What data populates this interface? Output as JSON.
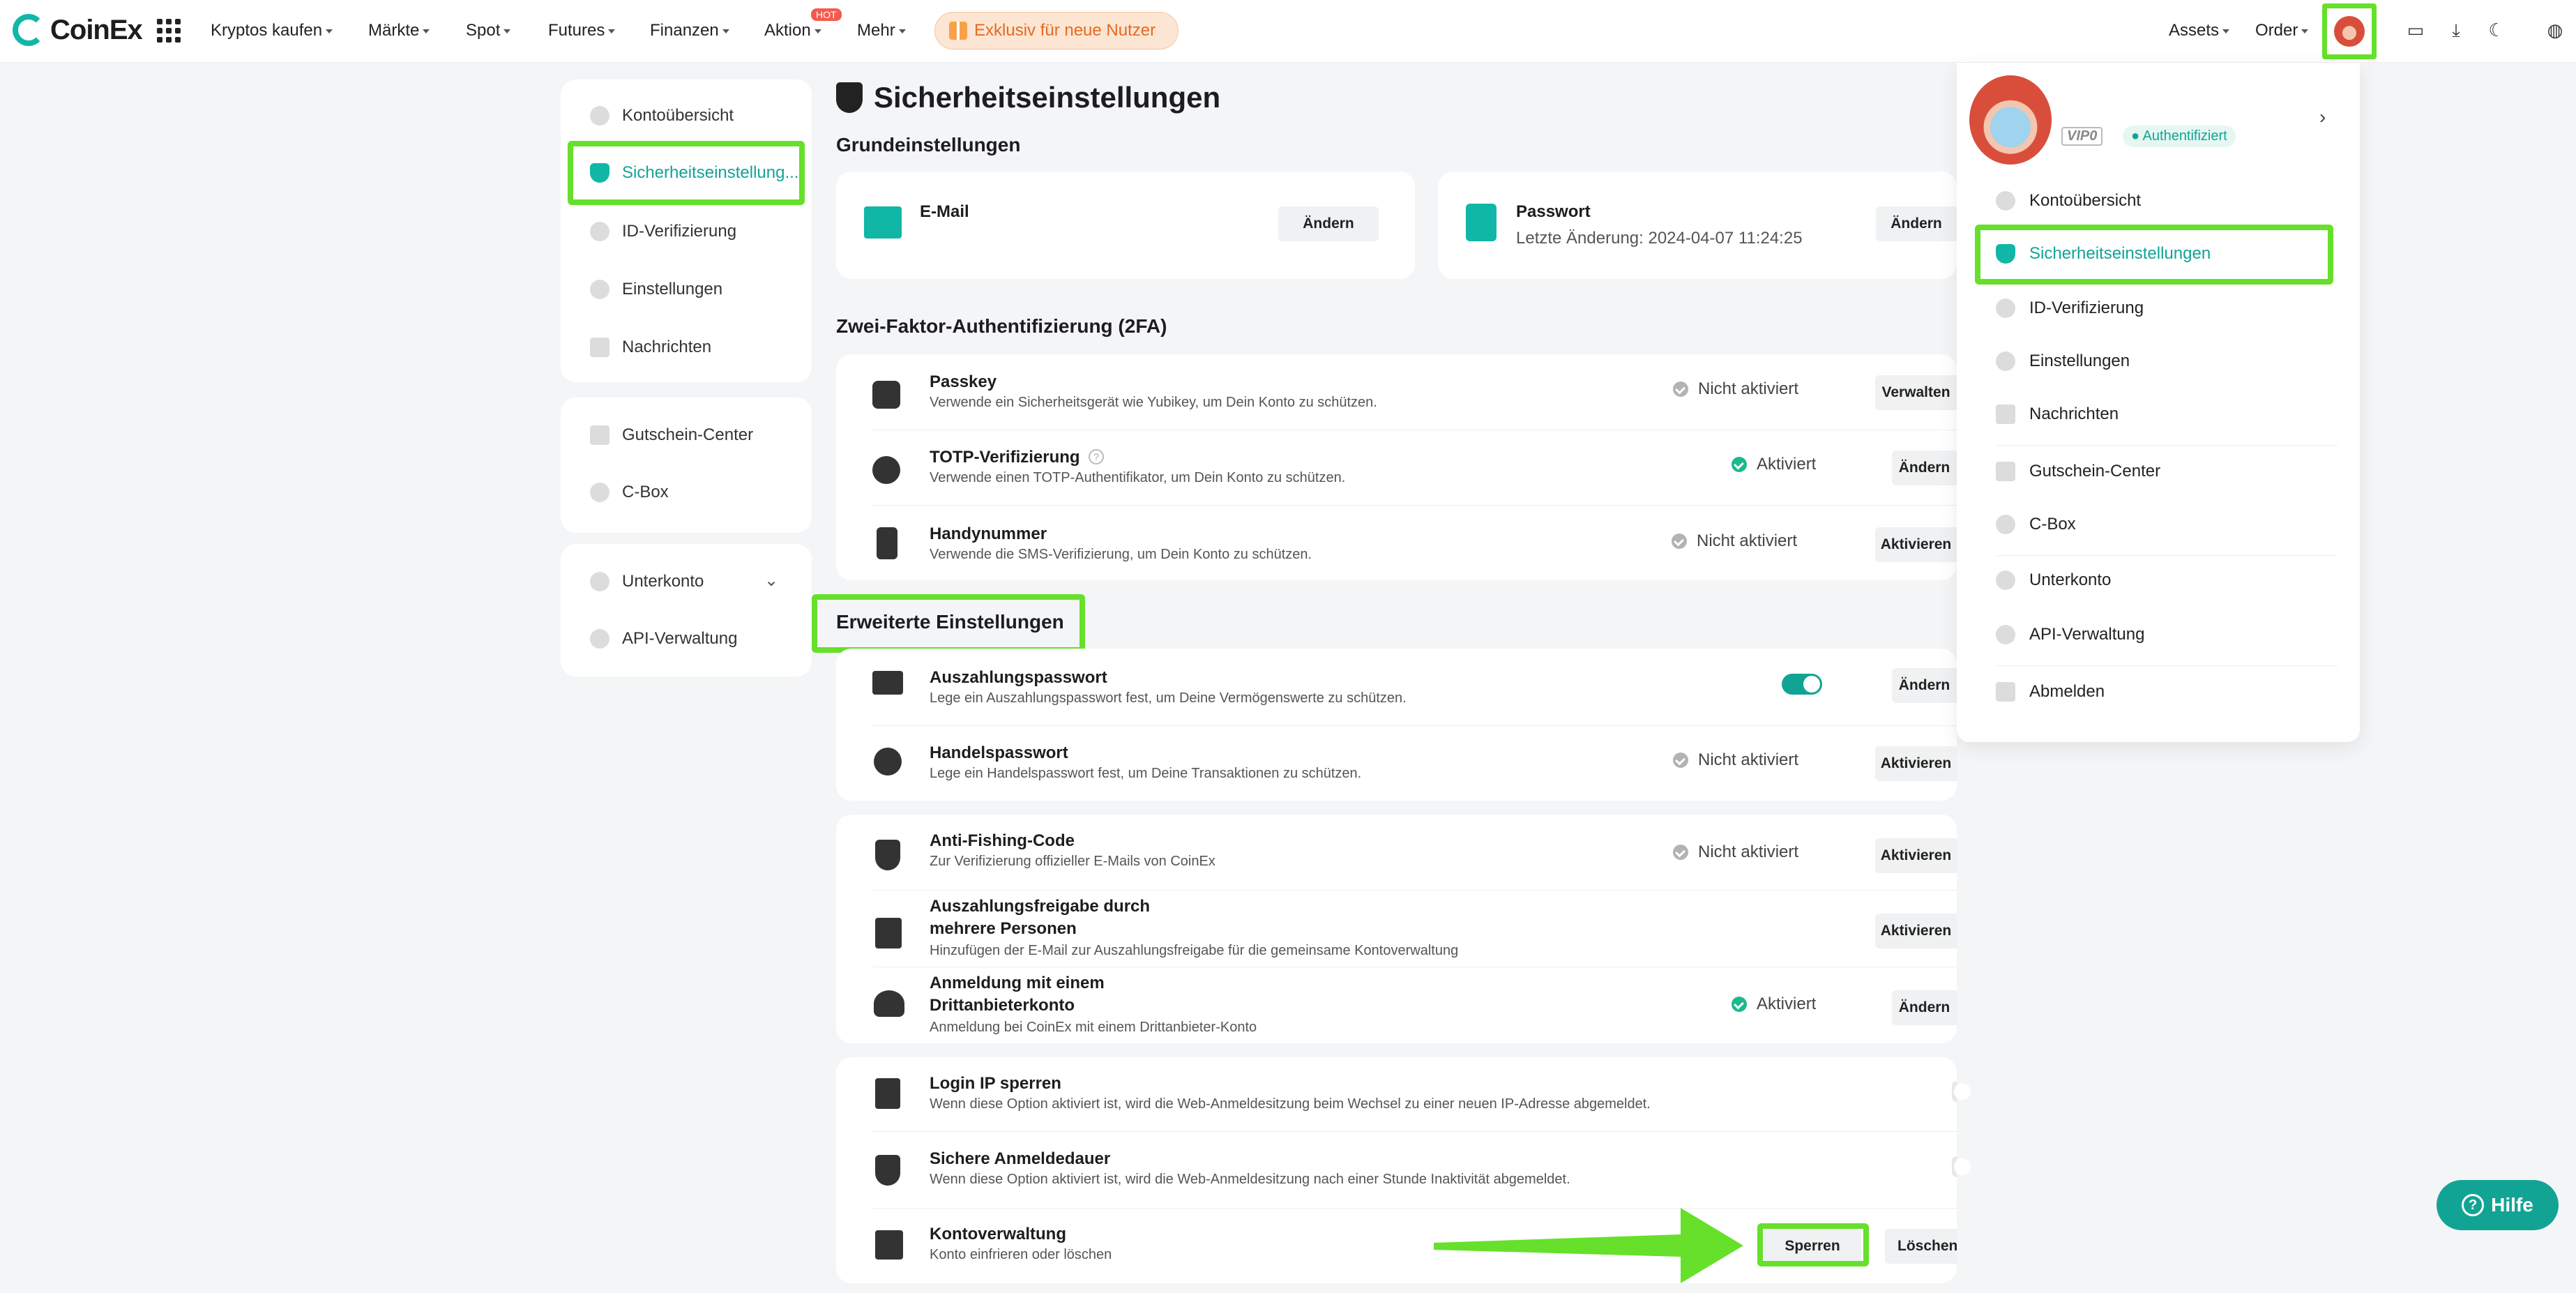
{
  "app": {
    "brand": "CoinEx",
    "accent": "#11a495",
    "highlight": "#66e02a"
  },
  "nav": {
    "items": [
      "Kryptos kaufen",
      "Märkte",
      "Spot",
      "Futures",
      "Finanzen",
      "Aktion",
      "Mehr"
    ],
    "hot_badge": "HOT",
    "promo": "Exklusiv für neue Nutzer",
    "right": [
      "Assets",
      "Order"
    ]
  },
  "sidebar": {
    "groups": [
      [
        "Kontoübersicht",
        "Sicherheitseinstellungen",
        "ID-Verifizierung",
        "Einstellungen",
        "Nachrichten"
      ],
      [
        "Gutschein-Center",
        "C-Box"
      ],
      [
        "Unterkonto",
        "API-Verwaltung"
      ]
    ],
    "active_display": "Sicherheitseinstellung..."
  },
  "page": {
    "title": "Sicherheitseinstellungen",
    "basic_title": "Grundeinstellungen",
    "email": {
      "label": "E-Mail",
      "button": "Ändern"
    },
    "password": {
      "label": "Passwort",
      "last_change": "Letzte Änderung: 2024-04-07 11:24:25",
      "button": "Ändern"
    },
    "twofa_title": "Zwei-Faktor-Authentifizierung (2FA)",
    "twofa": [
      {
        "title": "Passkey",
        "desc": "Verwende ein Sicherheitsgerät wie Yubikey, um Dein Konto zu schützen.",
        "status": "Nicht aktiviert",
        "button": "Verwalten"
      },
      {
        "title": "TOTP-Verifizierung",
        "desc": "Verwende einen TOTP-Authentifikator, um Dein Konto zu schützen.",
        "status": "Aktiviert",
        "button": "Ändern"
      },
      {
        "title": "Handynummer",
        "desc": "Verwende die SMS-Verifizierung, um Dein Konto zu schützen.",
        "status": "Nicht aktiviert",
        "button": "Aktivieren"
      }
    ],
    "advanced_title": "Erweiterte Einstellungen",
    "advanced_a": [
      {
        "title": "Auszahlungspasswort",
        "desc": "Lege ein Auszahlungspasswort fest, um Deine Vermögenswerte zu schützen.",
        "toggle": true,
        "button": "Ändern"
      },
      {
        "title": "Handelspasswort",
        "desc": "Lege ein Handelspasswort fest, um Deine Transaktionen zu schützen.",
        "status": "Nicht aktiviert",
        "button": "Aktivieren"
      }
    ],
    "advanced_b": [
      {
        "title": "Anti-Fishing-Code",
        "desc": "Zur Verifizierung offizieller E-Mails von CoinEx",
        "status": "Nicht aktiviert",
        "button": "Aktivieren"
      },
      {
        "title_1": "Auszahlungsfreigabe durch",
        "title_2": "mehrere Personen",
        "desc": "Hinzufügen der E-Mail zur Auszahlungsfreigabe für die gemeinsame Kontoverwaltung",
        "button": "Aktivieren"
      },
      {
        "title_1": "Anmeldung mit einem",
        "title_2": "Drittanbieterkonto",
        "desc": "Anmeldung bei CoinEx mit einem Drittanbieter-Konto",
        "status": "Aktiviert",
        "button": "Ändern"
      }
    ],
    "advanced_c": [
      {
        "title": "Login IP sperren",
        "desc": "Wenn diese Option aktiviert ist, wird die Web-Anmeldesitzung beim Wechsel zu einer neuen IP-Adresse abgemeldet.",
        "toggle": false
      },
      {
        "title": "Sichere Anmeldedauer",
        "desc": "Wenn diese Option aktiviert ist, wird die Web-Anmeldesitzung nach einer Stunde Inaktivität abgemeldet.",
        "toggle": false
      },
      {
        "title": "Kontoverwaltung",
        "desc": "Konto einfrieren oder löschen",
        "button_lock": "Sperren",
        "button_delete": "Löschen"
      }
    ]
  },
  "dropdown": {
    "vip": "VIP0",
    "verified": "Authentifiziert",
    "items": [
      "Kontoübersicht",
      "Sicherheitseinstellungen",
      "ID-Verifizierung",
      "Einstellungen",
      "Nachrichten",
      "Gutschein-Center",
      "C-Box",
      "Unterkonto",
      "API-Verwaltung",
      "Abmelden"
    ]
  },
  "help": "Hilfe"
}
